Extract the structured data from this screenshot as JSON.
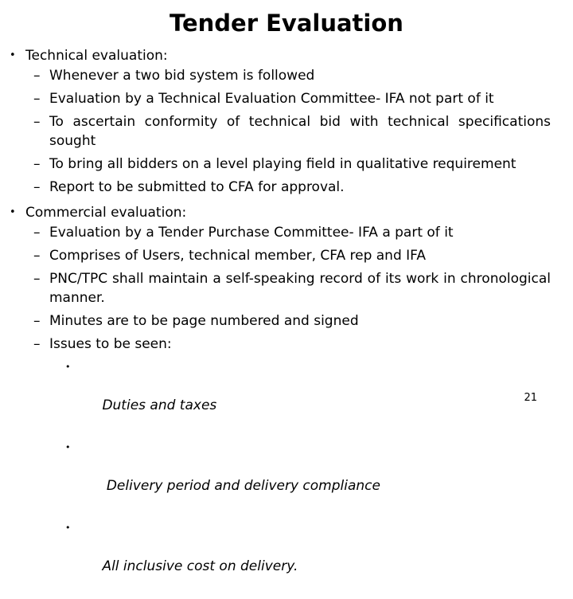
{
  "slide": {
    "title": "Tender Evaluation",
    "page_number": "21",
    "bullet_glyph_level1": "•",
    "bullet_glyph_level2": "–",
    "bullet_glyph_level3": "•",
    "sections": [
      {
        "heading": "Technical evaluation:",
        "items": [
          "Whenever a two bid system is followed",
          "Evaluation by a Technical Evaluation Committee- IFA not part of it",
          "To ascertain conformity of technical bid with technical specifications sought",
          "To bring all bidders on a level playing field in qualitative requirement",
          "Report to be submitted to CFA for approval."
        ]
      },
      {
        "heading": "Commercial evaluation:",
        "items": [
          "Evaluation by a Tender Purchase Committee- IFA a part of it",
          "Comprises of Users, technical member, CFA rep and IFA",
          "PNC/TPC shall maintain a self-speaking record of its work in chronological manner.",
          "Minutes  are to be page numbered and signed",
          "Issues to be seen:"
        ],
        "subitems": [
          "Duties and taxes",
          " Delivery period and delivery compliance",
          "All inclusive cost on delivery."
        ]
      }
    ]
  }
}
